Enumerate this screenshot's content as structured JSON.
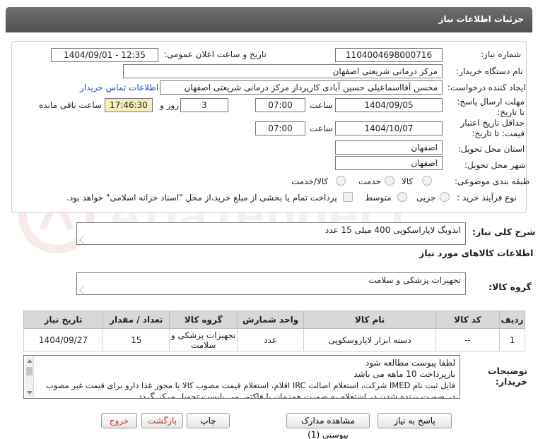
{
  "header": {
    "title": "جزئیات اطلاعات نیاز"
  },
  "labels": {
    "need_number": "شماره نیاز:",
    "announce_datetime": "تاریخ و ساعت اعلان عمومی:",
    "buyer_org": "نام دستگاه خریدار:",
    "requester": "ایجاد کننده درخواست:",
    "contact_link": "اطلاعات تماس خریدار",
    "send_deadline": "مهلت ارسال پاسخ: تا تاریخ:",
    "time_word": "ساعت",
    "day_and": "روز و",
    "remaining": "ساعت باقی مانده",
    "validity": "حداقل تاریخ اعتبار قیمت: تا تاریخ:",
    "province": "استان محل تحویل:",
    "city": "شهر محل تحویل:",
    "category": "طبقه بندی موضوعی:",
    "process": "نوع فرآیند خرید :",
    "payment_note": "پرداخت تمام یا بخشی از مبلغ خرید،از محل \"اسناد خزانه اسلامی\" خواهد بود.",
    "description": "شرح کلی نیاز:",
    "goods_info": "اطلاعات کالاهای مورد نیاز",
    "goods_group": "گروه کالا:",
    "buyer_notes": "توضیحات خریدار:"
  },
  "values": {
    "need_number": "1104004698000716",
    "announce_datetime": "1404/09/01 - 12:35",
    "buyer_org": "مرکز درمانی شریعتی اصفهان",
    "requester": "محسن آقااسماعیلی حسین آبادی کارپرداز مرکز درمانی شریعتی اصفهان",
    "send_date": "1404/09/05",
    "send_time": "07:00",
    "days": "3",
    "remaining_time": "17:46:30",
    "validity_date": "1404/10/07",
    "validity_time": "07:00",
    "province": "اصفهان",
    "city": "اصفهان",
    "description": "اندویگ لاپاراسکوپی 400 میلی 15 عدد",
    "goods_group": "تجهیزات پزشکی و سلامت"
  },
  "category_options": {
    "goods": "کالا",
    "service": "خدمت",
    "goods_service": "کالا/خدمت"
  },
  "process_options": {
    "minor": "جزیی",
    "medium": "متوسط"
  },
  "table": {
    "headers": [
      "ردیف",
      "کد کالا",
      "نام کالا",
      "واحد شمارش",
      "گروه کالا",
      "تعداد / مقدار",
      "تاریخ نیاز"
    ],
    "rows": [
      [
        "1",
        "--",
        "دسته ابزار لاپاروسکوپی",
        "عدد",
        "تجهیزات پزشکی و سلامت",
        "15",
        "1404/09/27"
      ]
    ]
  },
  "notes": [
    "لطفا پیوست مطالعه شود",
    "بازپرداخت 10 ماهه می باشد",
    "فایل ثبت نام IMED شرکت، استعلام اصالت IRC اقلام، استعلام قیمت مصوب کالا یا مجوز غذا دارو برای قیمت غیر مصوب",
    "در صورت برنده شدن در استعلام به صورت همزمان با فاکتور می بایست تحویل مرکز گردد."
  ],
  "buttons": {
    "reply": "پاسخ به نیاز",
    "attachments": "مشاهده مدارک پیوستی (1)",
    "print": "چاپ",
    "back": "بازگشت",
    "exit": "خروج"
  },
  "watermark_text": "AriaTender.net",
  "colors": {
    "header_bg": "#5a5a5a",
    "link": "#1f4fbf",
    "remaining_bg": "#f7edbc",
    "exit_red": "#c0392b"
  }
}
